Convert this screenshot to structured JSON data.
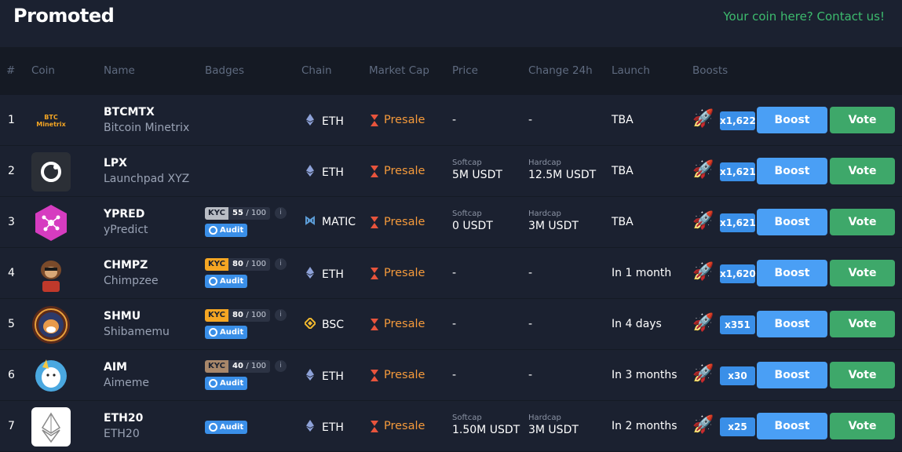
{
  "header": {
    "title": "Promoted",
    "contact": "Your coin here? Contact us!"
  },
  "columns": [
    "#",
    "Coin",
    "Name",
    "Badges",
    "Chain",
    "Market Cap",
    "Price",
    "Change 24h",
    "Launch",
    "Boosts"
  ],
  "labels": {
    "softcap": "Softcap",
    "hardcap": "Hardcap",
    "boost_btn": "Boost",
    "vote_btn": "Vote",
    "audit": "Audit",
    "kyc": "KYC",
    "score_of": "/ 100",
    "info": "i"
  },
  "colors": {
    "presale": "#f59a3b",
    "boost": "#4a9ff5",
    "vote": "#3ea86a",
    "contact": "#3dbb6e"
  },
  "rows": [
    {
      "num": "1",
      "symbol": "BTCMTX",
      "name": "Bitcoin Minetrix",
      "logo_text": "BTC Minetrix",
      "logo_icon": "bitcoin-minetrix-logo",
      "chain": "ETH",
      "chain_icon": "ethereum-icon",
      "market_cap": "Presale",
      "price": "-",
      "change": "-",
      "launch": "TBA",
      "boosts": "x1,622"
    },
    {
      "num": "2",
      "symbol": "LPX",
      "name": "Launchpad XYZ",
      "logo_icon": "launchpad-xyz-logo",
      "chain": "ETH",
      "chain_icon": "ethereum-icon",
      "market_cap": "Presale",
      "softcap": "5M USDT",
      "hardcap": "12.5M USDT",
      "launch": "TBA",
      "boosts": "x1,621"
    },
    {
      "num": "3",
      "symbol": "YPRED",
      "name": "yPredict",
      "logo_icon": "ypredict-logo",
      "kyc_score": "55",
      "kyc_color": "#b8bcc4",
      "audit": true,
      "chain": "MATIC",
      "chain_icon": "polygon-icon",
      "market_cap": "Presale",
      "softcap": "0 USDT",
      "hardcap": "3M USDT",
      "launch": "TBA",
      "boosts": "x1,621"
    },
    {
      "num": "4",
      "symbol": "CHMPZ",
      "name": "Chimpzee",
      "logo_icon": "chimpzee-logo",
      "kyc_score": "80",
      "kyc_color": "#f5a623",
      "audit": true,
      "chain": "ETH",
      "chain_icon": "ethereum-icon",
      "market_cap": "Presale",
      "price": "-",
      "change": "-",
      "launch": "In 1 month",
      "boosts": "x1,620"
    },
    {
      "num": "5",
      "symbol": "SHMU",
      "name": "Shibamemu",
      "logo_icon": "shibamemu-logo",
      "kyc_score": "80",
      "kyc_color": "#f5a623",
      "audit": true,
      "chain": "BSC",
      "chain_icon": "bnb-icon",
      "market_cap": "Presale",
      "price": "-",
      "change": "-",
      "launch": "In 4 days",
      "boosts": "x351"
    },
    {
      "num": "6",
      "symbol": "AIM",
      "name": "Aimeme",
      "logo_icon": "aimeme-logo",
      "kyc_score": "40",
      "kyc_color": "#a8876a",
      "audit": true,
      "chain": "ETH",
      "chain_icon": "ethereum-icon",
      "market_cap": "Presale",
      "price": "-",
      "change": "-",
      "launch": "In 3 months",
      "boosts": "x30"
    },
    {
      "num": "7",
      "symbol": "ETH20",
      "name": "ETH20",
      "logo_icon": "eth20-logo",
      "audit": true,
      "chain": "ETH",
      "chain_icon": "ethereum-icon",
      "market_cap": "Presale",
      "softcap": "1.50M USDT",
      "hardcap": "3M USDT",
      "launch": "In 2 months",
      "boosts": "x25"
    }
  ]
}
